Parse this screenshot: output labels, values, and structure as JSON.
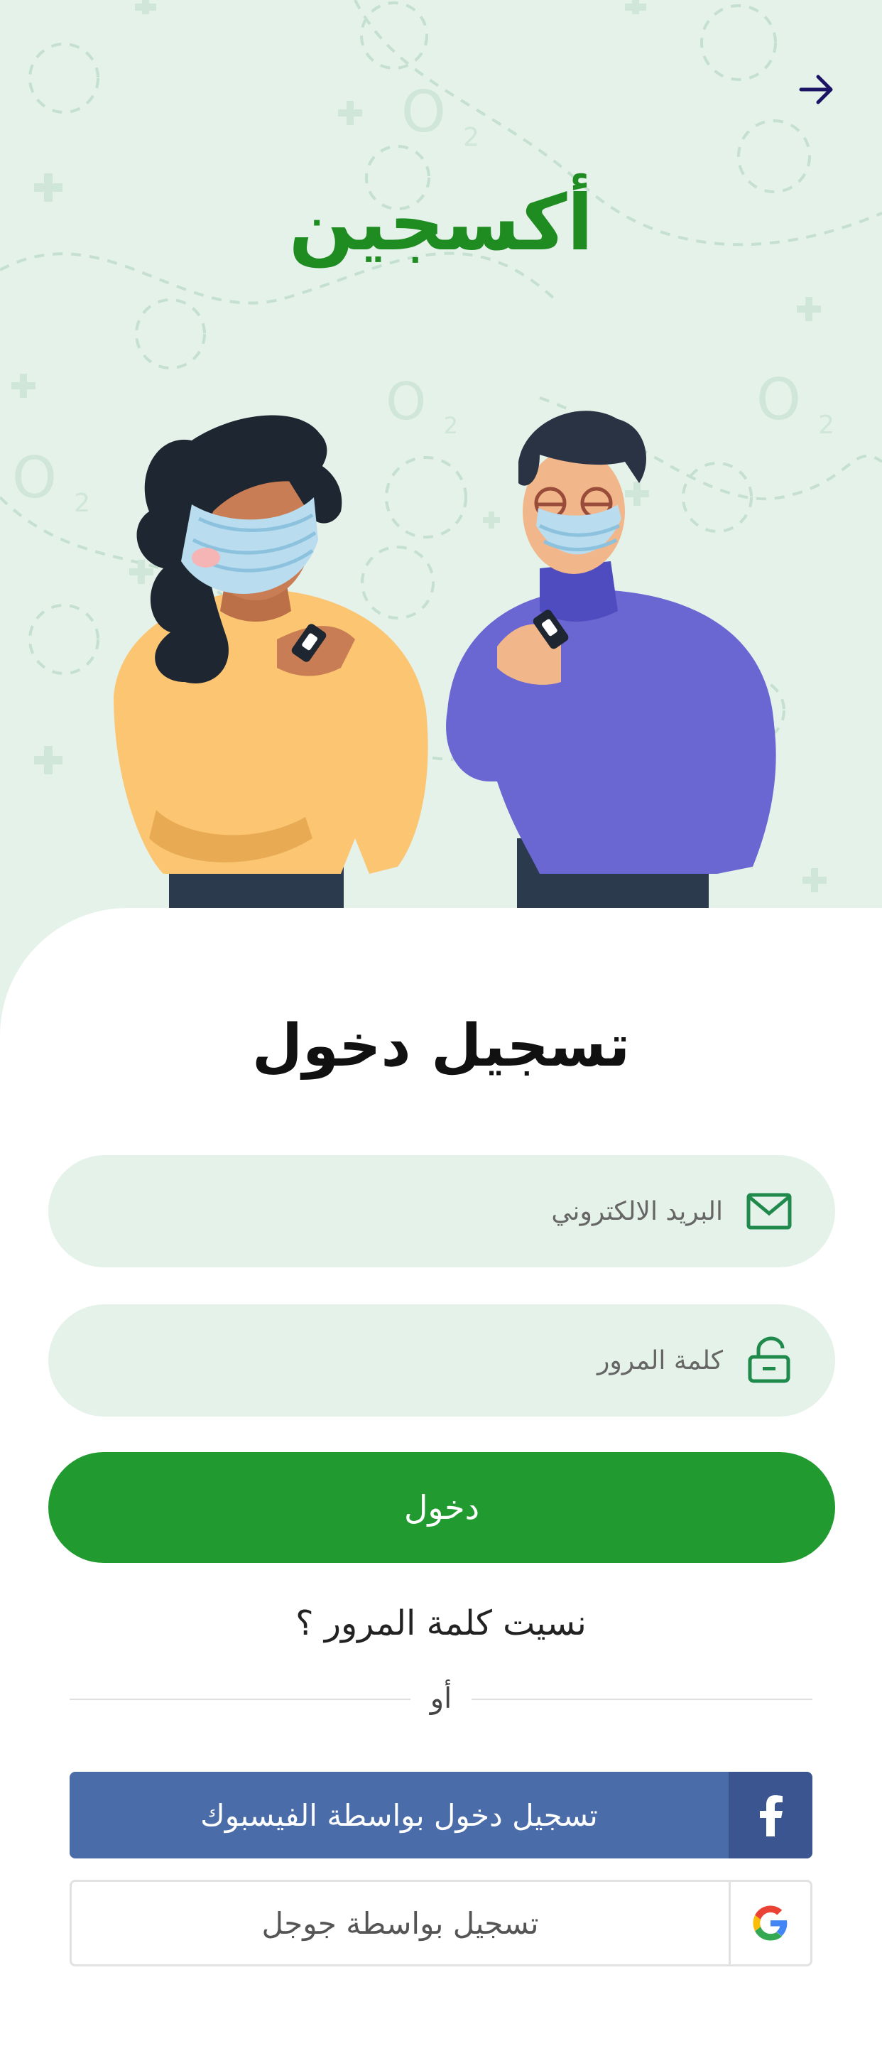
{
  "app": {
    "title": "أكسجين"
  },
  "login": {
    "heading": "تسجيل دخول"
  },
  "form": {
    "email_placeholder": "البريد الالكتروني",
    "password_placeholder": "كلمة المرور",
    "submit_label": "دخول",
    "forgot_label": "نسيت كلمة المرور ؟"
  },
  "divider": {
    "or_label": "أو"
  },
  "social": {
    "facebook_label": "تسجيل دخول بواسطة الفيسبوك",
    "google_label": "تسجيل بواسطة جوجل"
  },
  "icons": {
    "back": "arrow-right-icon",
    "email": "mail-icon",
    "password": "unlock-icon",
    "facebook": "facebook-icon",
    "google": "google-icon"
  },
  "colors": {
    "brand_green": "#1f8c22",
    "button_green": "#219a30",
    "hero_bg": "#e4f2ea",
    "facebook_blue": "#4a6ca8",
    "facebook_dark": "#3a5590"
  }
}
